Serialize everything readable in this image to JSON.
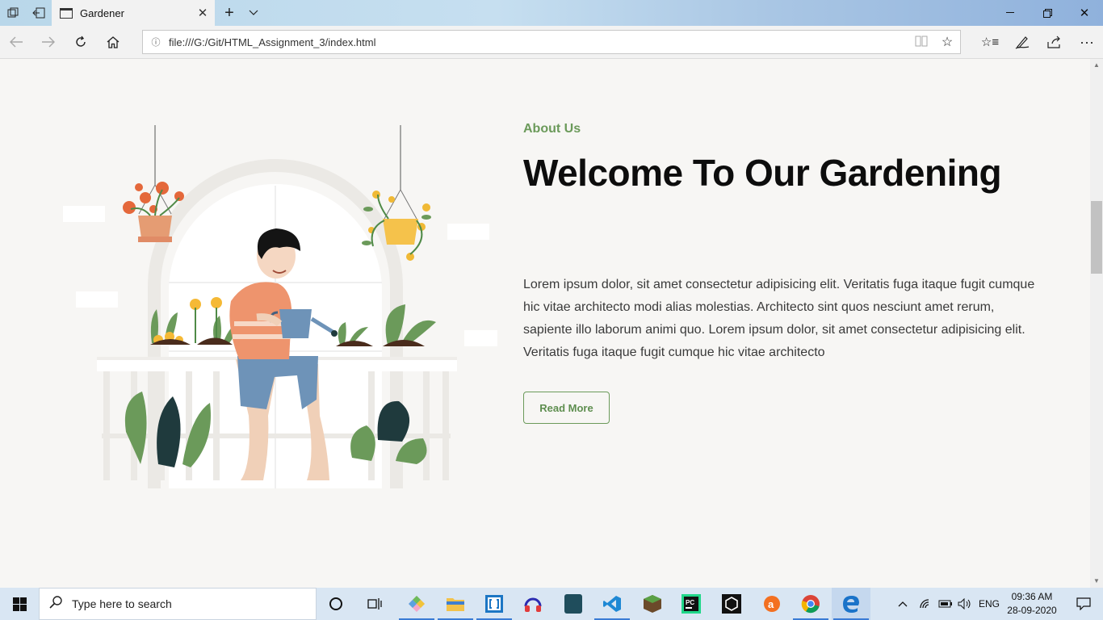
{
  "browser": {
    "tab_title": "Gardener",
    "url": "file:///G:/Git/HTML_Assignment_3/index.html"
  },
  "about": {
    "label": "About Us",
    "heading": "Welcome To Our Gardening",
    "body": "Lorem ipsum dolor, sit amet consectetur adipisicing elit. Veritatis fuga itaque fugit cumque hic vitae architecto modi alias molestias. Architecto sint quos nesciunt amet rerum, sapiente illo laborum animi quo. Lorem ipsum dolor, sit amet consectetur adipisicing elit. Veritatis fuga itaque fugit cumque hic vitae architecto",
    "button": "Read More"
  },
  "taskbar": {
    "search_placeholder": "Type here to search",
    "language": "ENG",
    "time": "09:36 AM",
    "date": "28-09-2020"
  },
  "colors": {
    "accent_green": "#6b9a5a",
    "page_bg": "#f7f6f4",
    "heading": "#0d0d0d"
  }
}
